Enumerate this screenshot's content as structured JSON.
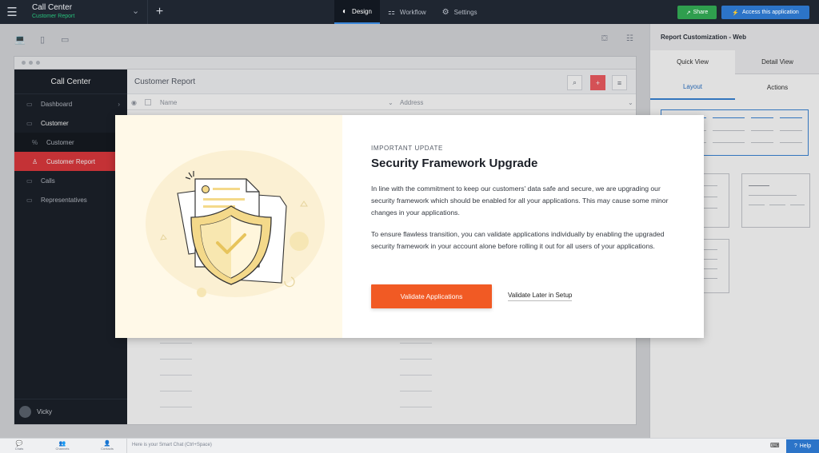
{
  "topbar": {
    "app_title": "Call Center",
    "app_subtitle": "Customer Report",
    "tabs": [
      {
        "label": "Design",
        "icon": "palette-icon",
        "active": true
      },
      {
        "label": "Workflow",
        "icon": "workflow-icon",
        "active": false
      },
      {
        "label": "Settings",
        "icon": "gear-icon",
        "active": false
      }
    ],
    "share_label": "Share",
    "access_label": "Access this application"
  },
  "app": {
    "sidebar_title": "Call Center",
    "menu": [
      {
        "label": "Dashboard",
        "icon": "monitor-icon",
        "level": 0,
        "active": false,
        "has_arrow": true
      },
      {
        "label": "Customer",
        "icon": "monitor-icon",
        "level": 0,
        "active": false,
        "has_arrow": false
      },
      {
        "label": "Customer",
        "icon": "percent-icon",
        "level": 1,
        "active": false,
        "has_arrow": false
      },
      {
        "label": "Customer Report",
        "icon": "user-icon",
        "level": 1,
        "active": true,
        "has_arrow": false
      },
      {
        "label": "Calls",
        "icon": "monitor-icon",
        "level": 0,
        "active": false,
        "has_arrow": false
      },
      {
        "label": "Representatives",
        "icon": "monitor-icon",
        "level": 0,
        "active": false,
        "has_arrow": false
      }
    ],
    "user_name": "Vicky",
    "report_title": "Customer Report",
    "columns": [
      "Name",
      "Address"
    ]
  },
  "right_panel": {
    "title": "Report Customization - Web",
    "tabs": [
      "Quick View",
      "Detail View"
    ],
    "subtabs": [
      "Layout",
      "Actions"
    ]
  },
  "bottombar": {
    "items": [
      "Chats",
      "Channels",
      "Contacts"
    ],
    "chat_placeholder": "Here is your Smart Chat (Ctrl+Space)",
    "help_label": "Help"
  },
  "modal": {
    "eyebrow": "IMPORTANT UPDATE",
    "title": "Security Framework Upgrade",
    "paragraph1": "In line with the commitment to keep our customers' data safe and secure, we are upgrading our security framework which should be enabled for all your applications. This may cause some minor changes in your applications.",
    "paragraph2": "To ensure flawless transition, you can validate applications individually by enabling the upgraded security framework in your account alone before rolling it out for all users of your applications.",
    "primary_label": "Validate Applications",
    "secondary_label": "Validate Later in Setup"
  },
  "colors": {
    "accent_orange": "#f15a24",
    "active_red": "#e0393e",
    "blue": "#2c74c8",
    "green": "#2f9e4e"
  }
}
